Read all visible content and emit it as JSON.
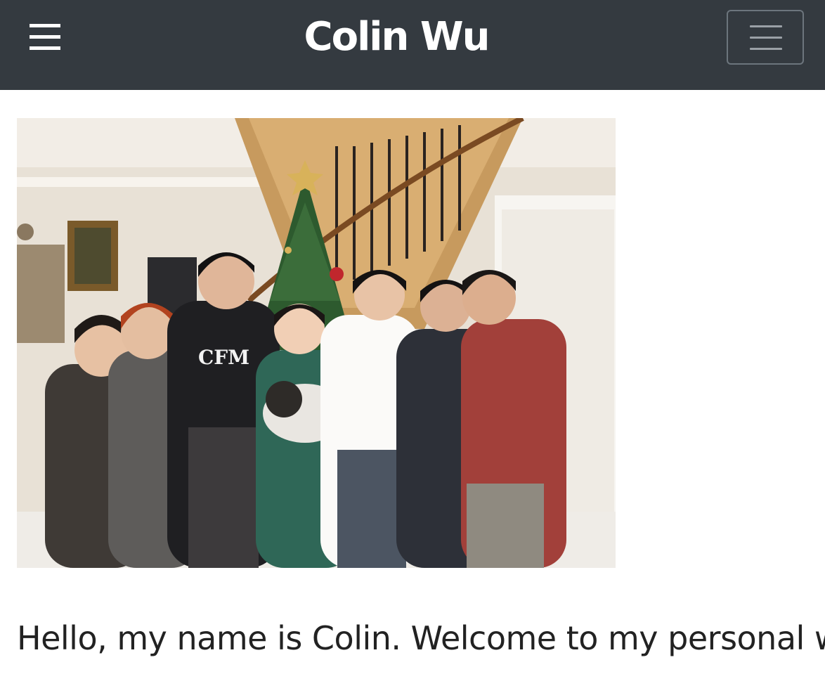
{
  "navbar": {
    "title": "Colin Wu",
    "menu_icon": "hamburger-icon",
    "toggler_icon": "hamburger-icon",
    "background": "#343a40"
  },
  "photo": {
    "description_alt": "family-photo"
  },
  "main": {
    "headline": "Hello, my name is Colin. Welcome to my personal website!"
  }
}
